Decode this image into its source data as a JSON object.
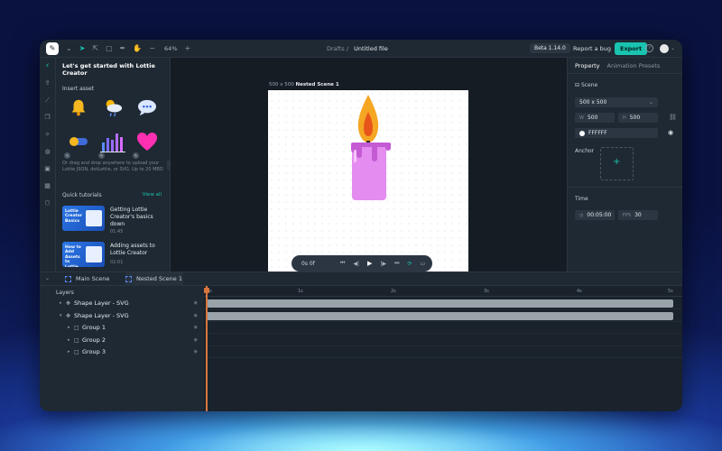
{
  "toolbar": {
    "zoom": "64%",
    "breadcrumb_root": "Drafts",
    "breadcrumb_sep": "/",
    "file_name": "Untitled file",
    "version": "Beta 1.14.0",
    "report_bug": "Report a bug",
    "export": "Export",
    "help": "?"
  },
  "assets": {
    "heading": "Let's get started with Lottie Creator",
    "insert_title": "Insert asset",
    "items": [
      "bell-icon",
      "weather-icon",
      "chat-bubble-icon",
      "toggle-icon",
      "bar-chart-icon",
      "heart-icon"
    ],
    "drop_text": "Or drag and drop anywhere to upload your Lottie JSON, dotLottie, or SVG. Up to 20 MBD",
    "tutorials_title": "Quick tutorials",
    "view_all": "View all",
    "tutorials": [
      {
        "thumb_text": "Lottie Creator Basics",
        "title": "Getting Lottie Creator's basics down",
        "duration": "01:45"
      },
      {
        "thumb_text": "How to Add Assets to Lottie Creator",
        "title": "Adding assets to Lottie Creator",
        "duration": "02:01"
      }
    ]
  },
  "canvas": {
    "size_label": "500 x 500",
    "scene_label": "Nested Scene 1",
    "player_time": "0s 0f"
  },
  "properties": {
    "tabs": [
      "Property",
      "Animation Presets"
    ],
    "scene_title": "Scene",
    "scene_size": "500 x 500",
    "width_label": "W",
    "width": "500",
    "height_label": "H",
    "height": "500",
    "bg_color": "FFFFFF",
    "anchor_title": "Anchor",
    "time_title": "Time",
    "duration": "00:05:00",
    "fps_label": "FPS",
    "fps": "30"
  },
  "timeline": {
    "tabs": [
      "Main Scene",
      "Nested Scene 1"
    ],
    "layers_title": "Layers",
    "layers": [
      {
        "name": "Shape Layer - SVG"
      },
      {
        "name": "Shape Layer - SVG"
      },
      {
        "name": "Group 1"
      },
      {
        "name": "Group 2"
      },
      {
        "name": "Group 3"
      }
    ],
    "ruler": [
      "0s",
      "1s",
      "2s",
      "3s",
      "4s",
      "5s"
    ]
  },
  "colors": {
    "accent": "#19c3b0",
    "panel": "#1f2933",
    "candle": "#e58cf0",
    "flame": "#f5a623",
    "playhead": "#d8753f"
  }
}
